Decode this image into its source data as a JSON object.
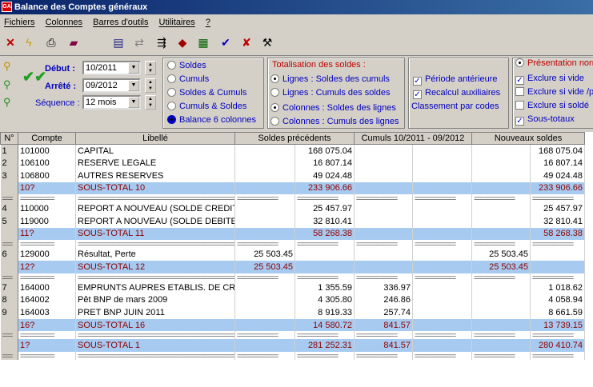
{
  "window": {
    "title": "Balance des Comptes généraux",
    "icon": "app-icon"
  },
  "menu": [
    "Fichiers",
    "Colonnes",
    "Barres d'outils",
    "Utilitaires",
    "?"
  ],
  "toolbar": [
    "close-icon",
    "lightning-icon",
    "print-icon",
    "book-icon",
    "table-icon",
    "refresh-icon",
    "flow-icon",
    "stamp-icon",
    "spreadsheet-icon",
    "check-icon",
    "cross-icon",
    "tool-icon"
  ],
  "dates": {
    "debut_label": "Début :",
    "debut_value": "10/2011",
    "arrete_label": "Arrêté :",
    "arrete_value": "09/2012",
    "sequence_label": "Séquence :",
    "sequence_value": "12 mois"
  },
  "view_options": [
    {
      "label": "Soldes",
      "selected": false
    },
    {
      "label": "Cumuls",
      "selected": false
    },
    {
      "label": "Soldes & Cumuls",
      "selected": false
    },
    {
      "label": "Cumuls & Soldes",
      "selected": false
    },
    {
      "label": "Balance 6 colonnes",
      "selected": true
    }
  ],
  "totalisation": {
    "title": "Totalisation des soldes :",
    "options": [
      {
        "label": "Lignes : Soldes des cumuls",
        "selected": true
      },
      {
        "label": "Lignes : Cumuls des soldes",
        "selected": false
      },
      {
        "label": "Colonnes : Soldes des lignes",
        "selected": true
      },
      {
        "label": "Colonnes : Cumuls des lignes",
        "selected": false
      }
    ]
  },
  "periode": {
    "checks": [
      {
        "label": "Période antérieure",
        "checked": true
      },
      {
        "label": "Recalcul auxiliaires",
        "checked": true
      }
    ],
    "link": "Classement par codes"
  },
  "presentation": {
    "radio": "Présentation norm",
    "checks": [
      {
        "label": "Exclure si vide",
        "checked": true
      },
      {
        "label": "Exclure si vide /p",
        "checked": false
      },
      {
        "label": "Exclure si soldé",
        "checked": false
      },
      {
        "label": "Sous-totaux",
        "checked": true
      }
    ]
  },
  "grid": {
    "headers": [
      "N°",
      "Compte",
      "Libellé",
      "Soldes précédents",
      "Cumuls 10/2011 - 09/2012",
      "Nouveaux soldes"
    ],
    "rows": [
      {
        "type": "data",
        "n": "1",
        "compte": "101000",
        "libelle": "CAPITAL",
        "sp_debit": "",
        "sp_credit": "168 075.04",
        "cumul_debit": "",
        "cumul_credit": "",
        "ns_debit": "",
        "ns_credit": "168 075.04"
      },
      {
        "type": "data",
        "n": "2",
        "compte": "106100",
        "libelle": "RESERVE LEGALE",
        "sp_debit": "",
        "sp_credit": "16 807.14",
        "cumul_debit": "",
        "cumul_credit": "",
        "ns_debit": "",
        "ns_credit": "16 807.14"
      },
      {
        "type": "data",
        "n": "3",
        "compte": "106800",
        "libelle": "AUTRES RESERVES",
        "sp_debit": "",
        "sp_credit": "49 024.48",
        "cumul_debit": "",
        "cumul_credit": "",
        "ns_debit": "",
        "ns_credit": "49 024.48"
      },
      {
        "type": "sub",
        "n": "",
        "compte": "10?",
        "libelle": "SOUS-TOTAL 10",
        "sp_debit": "",
        "sp_credit": "233 906.66",
        "cumul_debit": "",
        "cumul_credit": "",
        "ns_debit": "",
        "ns_credit": "233 906.66"
      },
      {
        "type": "sep"
      },
      {
        "type": "data",
        "n": "4",
        "compte": "110000",
        "libelle": "REPORT A NOUVEAU (SOLDE CREDIT",
        "sp_debit": "",
        "sp_credit": "25 457.97",
        "cumul_debit": "",
        "cumul_credit": "",
        "ns_debit": "",
        "ns_credit": "25 457.97"
      },
      {
        "type": "data",
        "n": "5",
        "compte": "119000",
        "libelle": "REPORT A NOUVEAU (SOLDE DEBITE",
        "sp_debit": "",
        "sp_credit": "32 810.41",
        "cumul_debit": "",
        "cumul_credit": "",
        "ns_debit": "",
        "ns_credit": "32 810.41"
      },
      {
        "type": "sub",
        "n": "",
        "compte": "11?",
        "libelle": "SOUS-TOTAL 11",
        "sp_debit": "",
        "sp_credit": "58 268.38",
        "cumul_debit": "",
        "cumul_credit": "",
        "ns_debit": "",
        "ns_credit": "58 268.38"
      },
      {
        "type": "sep"
      },
      {
        "type": "data",
        "n": "6",
        "compte": "129000",
        "libelle": "Résultat, Perte",
        "sp_debit": "25 503.45",
        "sp_credit": "",
        "cumul_debit": "",
        "cumul_credit": "",
        "ns_debit": "25 503.45",
        "ns_credit": ""
      },
      {
        "type": "sub",
        "n": "",
        "compte": "12?",
        "libelle": "SOUS-TOTAL 12",
        "sp_debit": "25 503.45",
        "sp_credit": "",
        "cumul_debit": "",
        "cumul_credit": "",
        "ns_debit": "25 503.45",
        "ns_credit": ""
      },
      {
        "type": "sep"
      },
      {
        "type": "data",
        "n": "7",
        "compte": "164000",
        "libelle": "EMPRUNTS AUPRES ETABLIS. DE CR",
        "sp_debit": "",
        "sp_credit": "1 355.59",
        "cumul_debit": "336.97",
        "cumul_credit": "",
        "ns_debit": "",
        "ns_credit": "1 018.62"
      },
      {
        "type": "data",
        "n": "8",
        "compte": "164002",
        "libelle": "Pêt BNP de mars 2009",
        "sp_debit": "",
        "sp_credit": "4 305.80",
        "cumul_debit": "246.86",
        "cumul_credit": "",
        "ns_debit": "",
        "ns_credit": "4 058.94"
      },
      {
        "type": "data",
        "n": "9",
        "compte": "164003",
        "libelle": "PRET BNP JUIN 2011",
        "sp_debit": "",
        "sp_credit": "8 919.33",
        "cumul_debit": "257.74",
        "cumul_credit": "",
        "ns_debit": "",
        "ns_credit": "8 661.59"
      },
      {
        "type": "sub",
        "n": "",
        "compte": "16?",
        "libelle": "SOUS-TOTAL 16",
        "sp_debit": "",
        "sp_credit": "14 580.72",
        "cumul_debit": "841.57",
        "cumul_credit": "",
        "ns_debit": "",
        "ns_credit": "13 739.15"
      },
      {
        "type": "sep"
      },
      {
        "type": "sub",
        "n": "",
        "compte": "1?",
        "libelle": "SOUS-TOTAL 1",
        "sp_debit": "",
        "sp_credit": "281 252.31",
        "cumul_debit": "841.57",
        "cumul_credit": "",
        "ns_debit": "",
        "ns_credit": "280 410.74"
      },
      {
        "type": "sep"
      }
    ]
  }
}
